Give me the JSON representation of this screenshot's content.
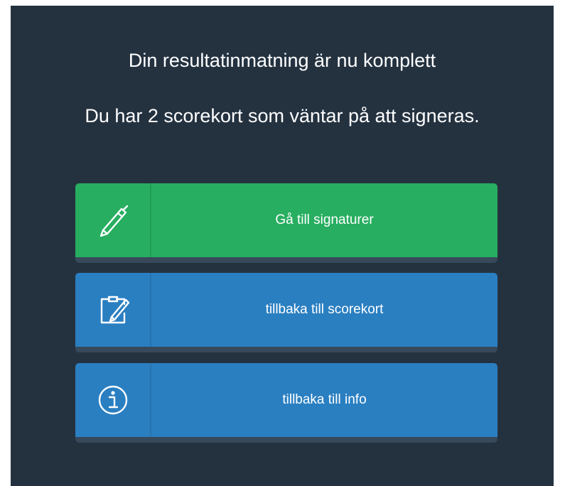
{
  "dialog": {
    "title": "Din resultatinmatning är nu komplett",
    "message": "Du har 2 scorekort som väntar på att signeras."
  },
  "actions": [
    {
      "label": "Gå till signaturer",
      "icon": "pen-icon",
      "color": "#27ae60"
    },
    {
      "label": "tillbaka till scorekort",
      "icon": "clipboard-edit-icon",
      "color": "#2a7fc1"
    },
    {
      "label": "tillbaka till info",
      "icon": "info-icon",
      "color": "#2a7fc1"
    }
  ],
  "colors": {
    "background": "#243240",
    "success": "#27ae60",
    "primary": "#2a7fc1"
  }
}
